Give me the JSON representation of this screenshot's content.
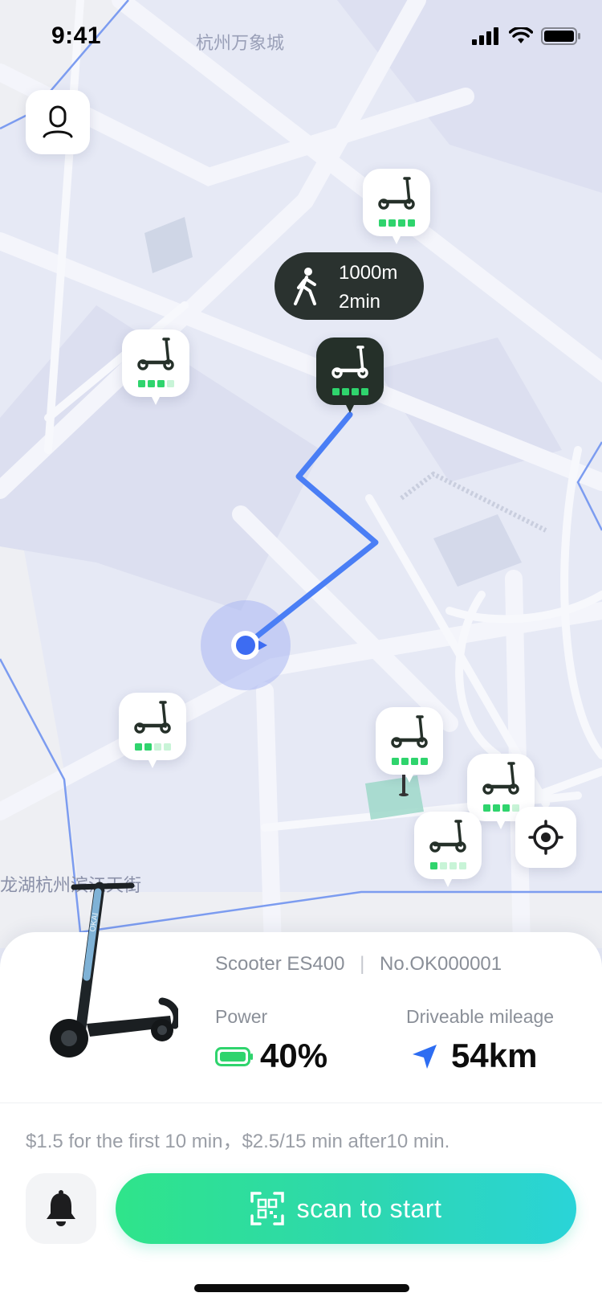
{
  "status_bar": {
    "time": "9:41"
  },
  "map": {
    "place_labels": {
      "top": "杭州万象城",
      "bottom": "龙湖杭州滨江天街"
    },
    "route_color": "#4a7ef5",
    "walk_info": {
      "distance": "1000m",
      "duration": "2min"
    },
    "scooter_pins": [
      {
        "selected": false,
        "battery_level": 4
      },
      {
        "selected": false,
        "battery_level": 3
      },
      {
        "selected": true,
        "battery_level": 4
      },
      {
        "selected": false,
        "battery_level": 2
      },
      {
        "selected": false,
        "battery_level": 4
      },
      {
        "selected": false,
        "battery_level": 3
      },
      {
        "selected": false,
        "battery_level": 1
      }
    ]
  },
  "scooter": {
    "model": "Scooter ES400",
    "number": "No.OK000001",
    "brand_mark": "OKAI",
    "power_label": "Power",
    "power_value": "40%",
    "power_percent": 40,
    "mileage_label": "Driveable mileage",
    "mileage_value": "54km"
  },
  "pricing": "$1.5 for the first 10 min，$2.5/15 min after10 min.",
  "actions": {
    "scan_label": "scan to start"
  },
  "colors": {
    "accent_start": "#2fe48a",
    "accent_end": "#2ad4d8",
    "battery_green": "#2fd46d"
  },
  "icons": [
    "user-icon",
    "walk-icon",
    "scooter-icon",
    "locate-icon",
    "battery-icon",
    "navigation-arrow-icon",
    "bell-icon",
    "scan-icon"
  ]
}
